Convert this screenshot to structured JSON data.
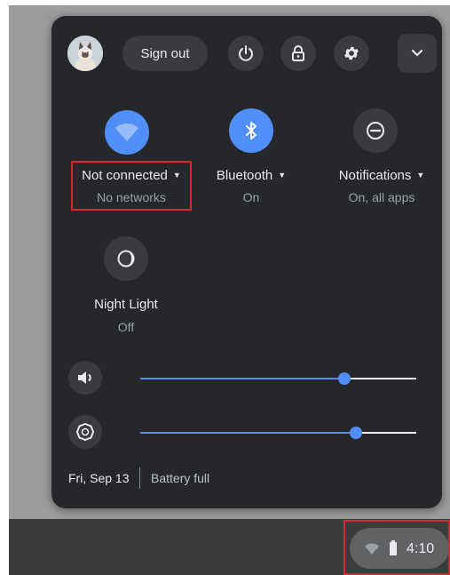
{
  "header": {
    "sign_out_label": "Sign out",
    "buttons": [
      "power-icon",
      "lock-icon",
      "gear-icon",
      "chevron-down-icon"
    ]
  },
  "tiles": {
    "network": {
      "label": "Not connected",
      "sublabel": "No networks",
      "icon": "wifi-icon",
      "active": true
    },
    "bluetooth": {
      "label": "Bluetooth",
      "sublabel": "On",
      "icon": "bluetooth-icon",
      "active": true
    },
    "notifications": {
      "label": "Notifications",
      "sublabel": "On, all apps",
      "icon": "do-not-disturb-icon",
      "active": false
    },
    "night_light": {
      "label": "Night Light",
      "sublabel": "Off",
      "icon": "night-light-icon",
      "active": false
    }
  },
  "sliders": {
    "volume": {
      "icon": "volume-icon",
      "level": 0.74
    },
    "brightness": {
      "icon": "brightness-icon",
      "level": 0.78
    }
  },
  "footer": {
    "date": "Fri, Sep 13",
    "battery_status": "Battery full"
  },
  "shelf": {
    "time": "4:10",
    "icons": [
      "wifi-icon",
      "battery-icon"
    ]
  },
  "colors": {
    "panel_bg": "#26272b",
    "accent_blue": "#4f8ff7",
    "button_bg": "#3a3b40",
    "highlight_red": "#d9262c",
    "shelf_bg": "#3b3b3d"
  }
}
